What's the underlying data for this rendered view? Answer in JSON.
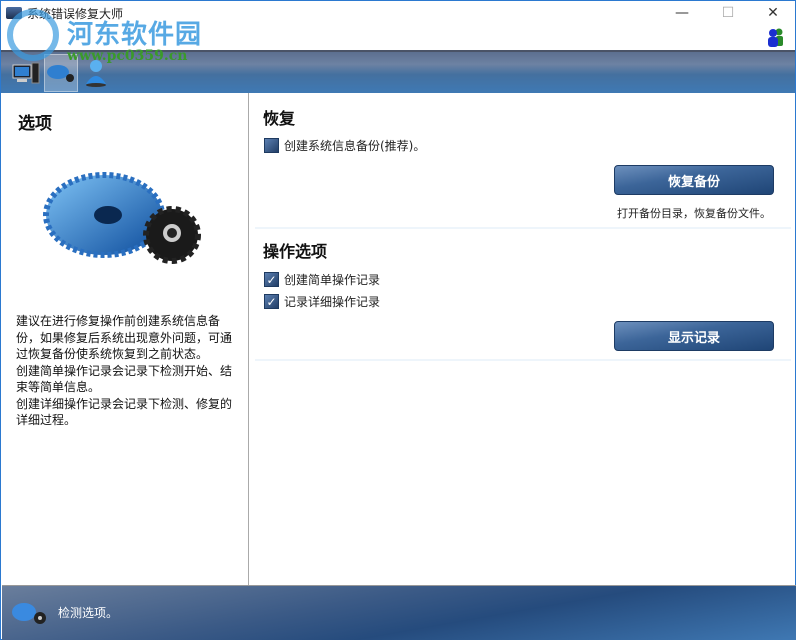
{
  "window": {
    "title": "系统错误修复大师",
    "minimize": "—",
    "maximize": "☐",
    "close": "✕"
  },
  "watermark": {
    "name": "河东软件园",
    "url": "www.pc0359.cn"
  },
  "toolbar": {
    "items": [
      {
        "icon": "computer-icon"
      },
      {
        "icon": "gear-icon"
      },
      {
        "icon": "user-icon"
      }
    ]
  },
  "left": {
    "title": "选项",
    "description": "建议在进行修复操作前创建系统信息备份，如果修复后系统出现意外问题，可通过恢复备份使系统恢复到之前状态。\n创建简单操作记录会记录下检测开始、结束等简单信息。\n创建详细操作记录会记录下检测、修复的详细过程。"
  },
  "restore": {
    "title": "恢复",
    "backup_checkbox": {
      "label": "创建系统信息备份(推荐)。",
      "checked": false
    },
    "button": "恢复备份",
    "hint": "打开备份目录，恢复备份文件。"
  },
  "ops": {
    "title": "操作选项",
    "simple_log": {
      "label": "创建简单操作记录",
      "checked": true
    },
    "detail_log": {
      "label": "记录详细操作记录",
      "checked": true
    },
    "button": "显示记录"
  },
  "status": {
    "text": "检测选项。"
  },
  "check_mark": "✓"
}
